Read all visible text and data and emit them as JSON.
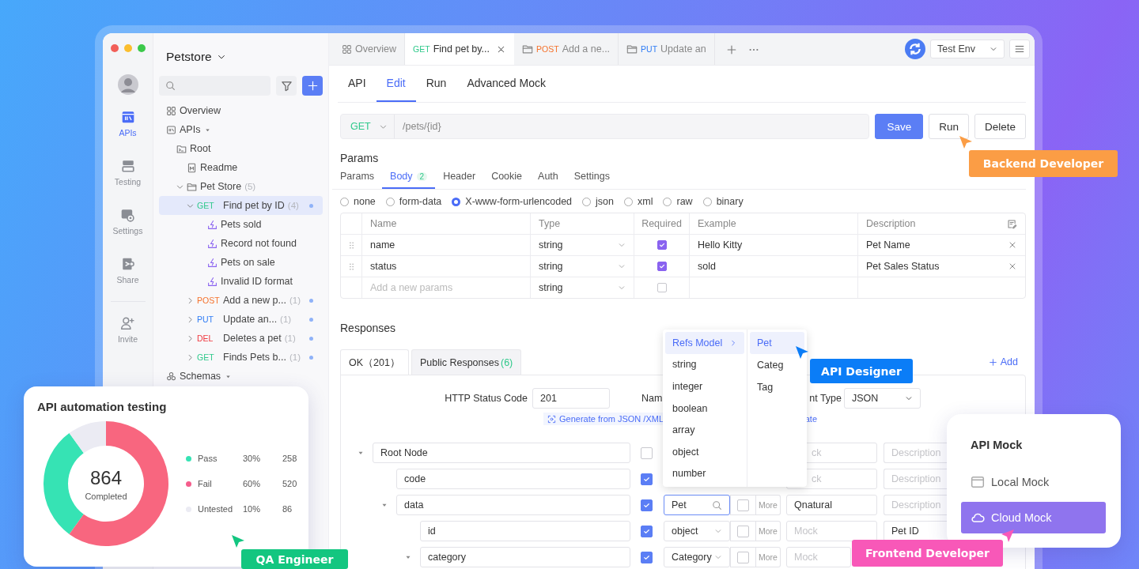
{
  "nav_rail": {
    "items": [
      {
        "label": "APIs",
        "kind": "apis",
        "selected": true
      },
      {
        "label": "Testing",
        "kind": "testing",
        "selected": false
      },
      {
        "label": "Settings",
        "kind": "settings",
        "selected": false
      },
      {
        "label": "Share",
        "kind": "share",
        "selected": false
      },
      {
        "label": "Invite",
        "kind": "invite",
        "selected": false
      }
    ]
  },
  "sidebar": {
    "project": "Petstore",
    "tree": [
      {
        "label": "Overview",
        "kind": "overview"
      },
      {
        "label": "APIs",
        "kind": "apis",
        "expanded": true,
        "children": [
          {
            "label": "Root",
            "kind": "root",
            "children": [
              {
                "label": "Readme",
                "kind": "doc"
              },
              {
                "label": "Pet Store",
                "count": "(5)",
                "kind": "folder",
                "expanded": true,
                "children": [
                  {
                    "method": "GET",
                    "color": "#2fc98b",
                    "label": "Find pet by ID",
                    "count": "(4)",
                    "kind": "api",
                    "expanded": true,
                    "selected": true,
                    "children": [
                      {
                        "label": "Pets sold",
                        "kind": "case"
                      },
                      {
                        "label": "Record not found",
                        "kind": "case"
                      },
                      {
                        "label": "Pets on sale",
                        "kind": "case"
                      },
                      {
                        "label": "Invalid ID format",
                        "kind": "case"
                      }
                    ]
                  },
                  {
                    "method": "POST",
                    "color": "#f5722c",
                    "label": "Add a new p...",
                    "count": "(1)",
                    "kind": "api",
                    "expanded": false,
                    "selected": false
                  },
                  {
                    "method": "PUT",
                    "color": "#2f7cf5",
                    "label": "Update an...",
                    "count": "(1)",
                    "kind": "api",
                    "expanded": false,
                    "selected": false
                  },
                  {
                    "method": "DEL",
                    "color": "#f0383f",
                    "label": "Deletes a pet",
                    "count": "(1)",
                    "kind": "api",
                    "expanded": false,
                    "selected": false
                  },
                  {
                    "method": "GET",
                    "color": "#2fc98b",
                    "label": "Finds Pets b...",
                    "count": "(1)",
                    "kind": "api",
                    "expanded": false,
                    "selected": false
                  }
                ]
              }
            ]
          }
        ]
      },
      {
        "label": "Schemas",
        "kind": "schemas",
        "expanded": true
      }
    ]
  },
  "tabs": [
    {
      "label": "Overview",
      "kind": "overview",
      "selected": false
    },
    {
      "method": "GET",
      "color": "#2fc98b",
      "label": "Find pet by...",
      "kind": "api",
      "selected": true
    },
    {
      "method": "POST",
      "color": "#f5722c",
      "label": "Add a ne...",
      "kind": "folder",
      "selected": false
    },
    {
      "method": "PUT",
      "color": "#2f7cf5",
      "label": "Update an",
      "kind": "folder",
      "selected": false
    }
  ],
  "environment": {
    "value": "Test Env"
  },
  "editor_tabs": [
    {
      "label": "API",
      "selected": false
    },
    {
      "label": "Edit",
      "selected": true
    },
    {
      "label": "Run",
      "selected": false
    },
    {
      "label": "Advanced Mock",
      "selected": false
    }
  ],
  "request": {
    "method": "GET",
    "color": "#2fc98b",
    "path": "/pets/{id}"
  },
  "buttons": [
    {
      "label": "Save",
      "kind": "primary"
    },
    {
      "label": "Run",
      "kind": "default"
    },
    {
      "label": "Delete",
      "kind": "default"
    }
  ],
  "params_title": "Params",
  "param_tabs": [
    {
      "label": "Params",
      "selected": false
    },
    {
      "label": "Body",
      "badge": "2",
      "selected": true
    },
    {
      "label": "Header",
      "selected": false
    },
    {
      "label": "Cookie",
      "selected": false
    },
    {
      "label": "Auth",
      "selected": false
    },
    {
      "label": "Settings",
      "selected": false
    }
  ],
  "body_types": [
    {
      "label": "none",
      "selected": false
    },
    {
      "label": "form-data",
      "selected": false
    },
    {
      "label": "X-www-form-urlencoded",
      "selected": true
    },
    {
      "label": "json",
      "selected": false
    },
    {
      "label": "xml",
      "selected": false
    },
    {
      "label": "raw",
      "selected": false
    },
    {
      "label": "binary",
      "selected": false
    }
  ],
  "params_table": {
    "columns": [
      "Name",
      "Type",
      "Required",
      "Example",
      "Description"
    ],
    "rows": [
      {
        "kind": "param",
        "name": "name",
        "type": "string",
        "required": true,
        "example": "Hello Kitty",
        "description": "Pet Name"
      },
      {
        "kind": "param",
        "name": "status",
        "type": "string",
        "required": true,
        "example": "sold",
        "description": "Pet Sales Status"
      },
      {
        "kind": "new",
        "placeholder": "Add a new params",
        "type": "string",
        "required": false
      }
    ]
  },
  "responses": {
    "title": "Responses",
    "tabs": [
      {
        "label": "OK（201）",
        "selected": true
      },
      {
        "label": "Public Responses",
        "count": "(6)",
        "selected": false
      }
    ],
    "add": "Add",
    "status_label": "HTTP Status Code",
    "status_code": "201",
    "name_label": "Nam",
    "content_type_label": "nt Type",
    "content_type": "JSON",
    "generate_link": "Generate from JSON /XML",
    "generate_link_2": "ate",
    "schema": [
      {
        "name": "Root Node",
        "required": false,
        "expanded": true,
        "mock_placeholder": "ck",
        "description_placeholder": "Description",
        "children": [
          {
            "name": "code",
            "required": true,
            "mock_placeholder": "ck",
            "description_placeholder": "Description"
          },
          {
            "name": "data",
            "required": true,
            "expanded": true,
            "type": "Pet",
            "kind": "search",
            "nullable": false,
            "more": "More",
            "mock": "Qnatural",
            "description_placeholder": "Description",
            "children": [
              {
                "name": "id",
                "required": true,
                "type": "object",
                "kind": "select",
                "nullable": false,
                "more": "More",
                "mock_placeholder": "Mock",
                "description": "Pet ID"
              },
              {
                "name": "category",
                "required": true,
                "expanded": true,
                "type": "Category",
                "kind": "select",
                "nullable": false,
                "more": "More",
                "mock_placeholder": "Mock"
              }
            ]
          }
        ]
      }
    ]
  },
  "type_menu": {
    "items": [
      {
        "label": "Refs Model",
        "kind": "submenu",
        "selected": true
      },
      {
        "label": "string",
        "kind": "item",
        "selected": false
      },
      {
        "label": "integer",
        "kind": "item",
        "selected": false
      },
      {
        "label": "boolean",
        "kind": "item",
        "selected": false
      },
      {
        "label": "array",
        "kind": "item",
        "selected": false
      },
      {
        "label": "object",
        "kind": "item",
        "selected": false
      },
      {
        "label": "number",
        "kind": "item",
        "selected": false
      }
    ],
    "submenu": [
      {
        "label": "Pet",
        "selected": true
      },
      {
        "label": "Categ",
        "selected": false
      },
      {
        "label": "Tag",
        "selected": false
      }
    ]
  },
  "test_card": {
    "title": "API automation testing",
    "total": "864",
    "total_label": "Completed",
    "chart_data": {
      "type": "donut",
      "categories": [
        "Pass",
        "Fail",
        "Untested"
      ],
      "values": [
        30,
        60,
        10
      ],
      "colors": [
        "#36e3b4",
        "#f8667f",
        "#ebebf3"
      ]
    },
    "legend": [
      {
        "percent": "30%",
        "count": "258",
        "color": "#36e3b4"
      },
      {
        "percent": "60%",
        "count": "520",
        "color": "#f55d8c"
      },
      {
        "percent": "10%",
        "count": "86",
        "color": "#ebebf3"
      }
    ]
  },
  "mock_card": {
    "title": "API Mock",
    "options": [
      {
        "label": "Local Mock",
        "kind": "local",
        "selected": false
      },
      {
        "label": "Cloud Mock",
        "kind": "cloud",
        "selected": true
      }
    ]
  },
  "role_tags": [
    {
      "label": "Backend Developer",
      "color": "#fb9d45"
    },
    {
      "label": "API Designer",
      "color": "#0b7df7"
    },
    {
      "label": "QA Engineer",
      "color": "#13c680"
    },
    {
      "label": "Frontend Developer",
      "color": "#f858b8"
    }
  ]
}
